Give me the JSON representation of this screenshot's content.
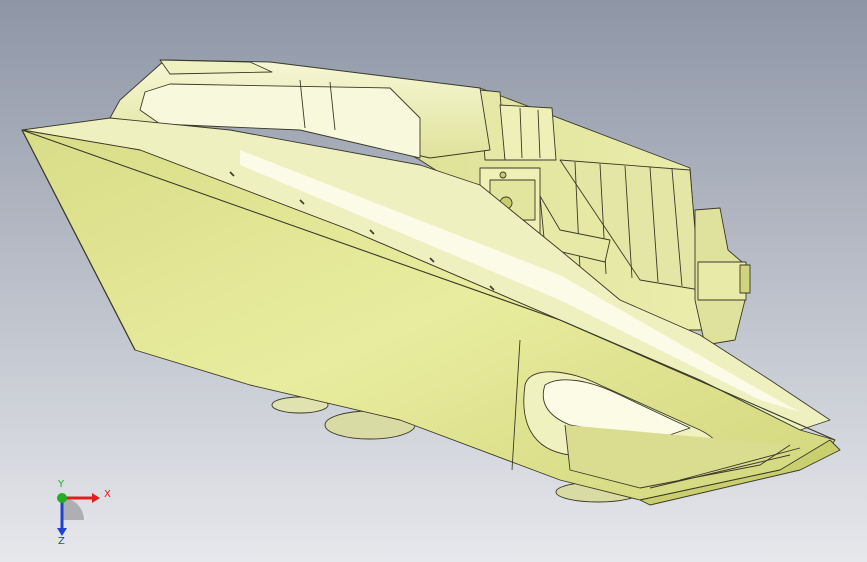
{
  "viewport": {
    "background_top": "#8e96a6",
    "background_bottom": "#e7e8ec",
    "model_fill": "#e6ea9c",
    "model_shade": "#c9ce6e",
    "model_light": "#f6f7d6",
    "model_edge": "#3a3a28"
  },
  "triad": {
    "x_label": "X",
    "y_label": "Y",
    "z_label": "Z",
    "x_color": "#e02020",
    "y_color": "#20b020",
    "z_color": "#2040d0"
  }
}
